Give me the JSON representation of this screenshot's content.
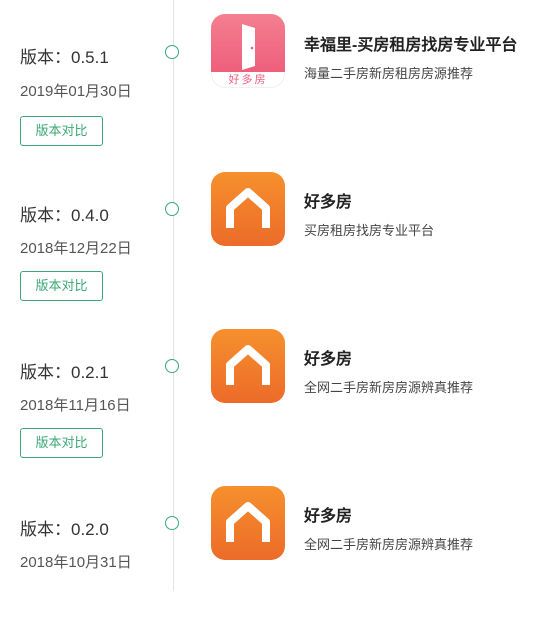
{
  "releases": [
    {
      "version": "版本：0.5.1",
      "date": "2019年01月30日",
      "compare_label": "版本对比",
      "app_name": "幸福里-买房租房找房专业平台",
      "app_subtitle": "海量二手房新房租房房源推荐",
      "icon": "door-icon",
      "icon_text": "好多房",
      "icon_color": "#ee5f7c"
    },
    {
      "version": "版本：0.4.0",
      "date": "2018年12月22日",
      "compare_label": "版本对比",
      "app_name": "好多房",
      "app_subtitle": "买房租房找房专业平台",
      "icon": "house-icon",
      "icon_color": "#ef7a2b"
    },
    {
      "version": "版本：0.2.1",
      "date": "2018年11月16日",
      "compare_label": "版本对比",
      "app_name": "好多房",
      "app_subtitle": "全网二手房新房房源辨真推荐",
      "icon": "house-icon",
      "icon_color": "#ef7a2b"
    },
    {
      "version": "版本：0.2.0",
      "date": "2018年10月31日",
      "app_name": "好多房",
      "app_subtitle": "全网二手房新房房源辨真推荐",
      "icon": "house-icon",
      "icon_color": "#ef7a2b"
    }
  ],
  "accent_color": "#3aa876"
}
